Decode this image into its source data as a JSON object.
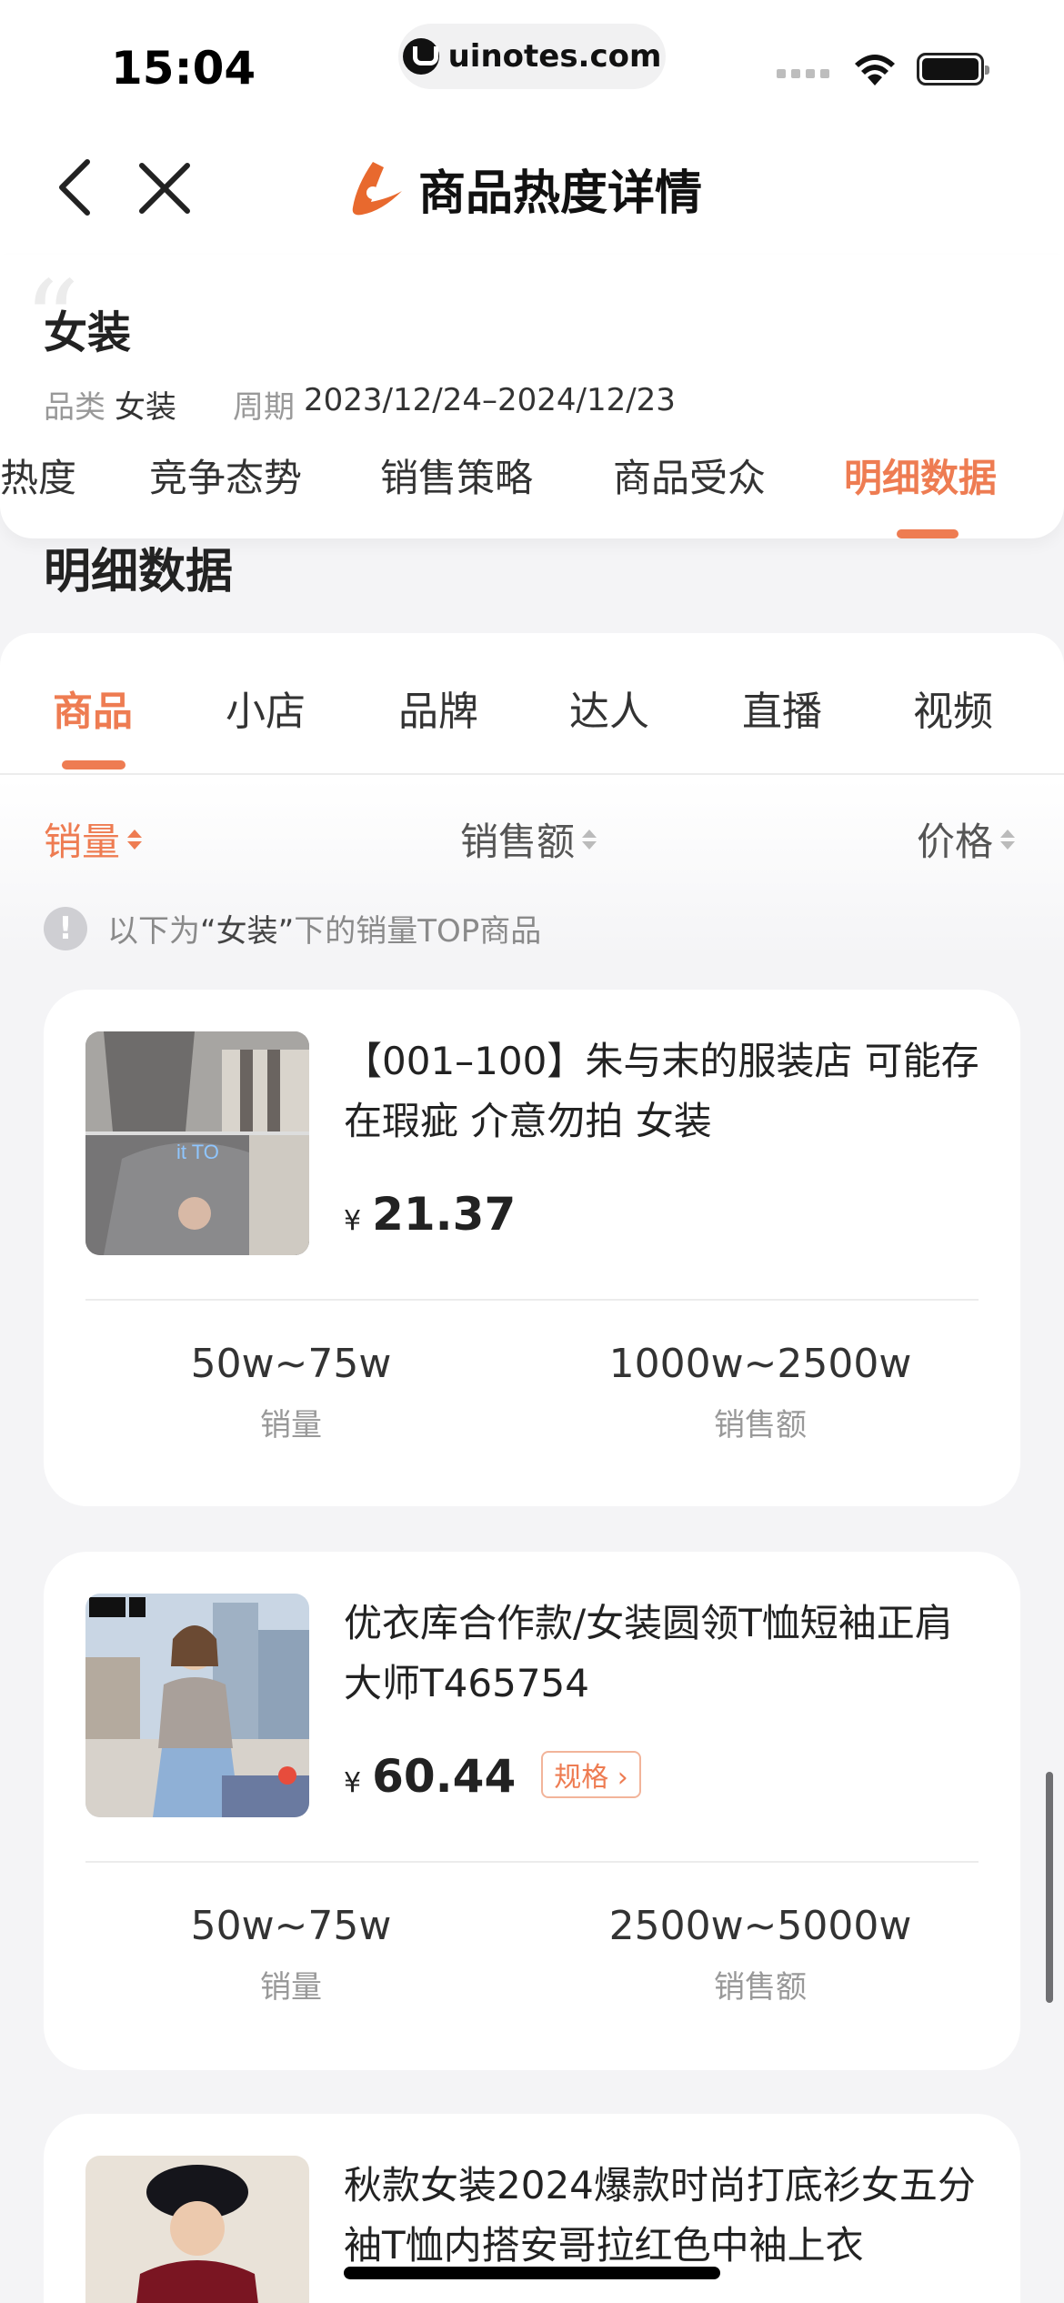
{
  "status_bar": {
    "time": "15:04",
    "url": "uinotes.com"
  },
  "nav": {
    "title": "商品热度详情"
  },
  "info": {
    "category_title": "女装",
    "category_label": "品类",
    "category_value": "女装",
    "period_label": "周期",
    "period_value": "2023/12/24–2024/12/23"
  },
  "top_tabs": [
    "热度",
    "竞争态势",
    "销售策略",
    "商品受众",
    "明细数据"
  ],
  "top_tab_active": "明细数据",
  "section_title": "明细数据",
  "sub_tabs": [
    "商品",
    "小店",
    "品牌",
    "达人",
    "直播",
    "视频"
  ],
  "sub_tab_active": "商品",
  "sort": {
    "sales": "销量",
    "revenue": "销售额",
    "price": "价格"
  },
  "notice": {
    "pre": "以下为",
    "highlight": "“女装”",
    "post": "下的销量TOP商品"
  },
  "products": [
    {
      "title": "【001–100】朱与末的服装店 可能存在瑕疵 介意勿拍 女装",
      "currency": "¥",
      "price": "21.37",
      "sales": "50w~75w",
      "sales_label": "销量",
      "revenue": "1000w~2500w",
      "revenue_label": "销售额"
    },
    {
      "title": "优衣库合作款/女装圆领T恤短袖正肩大师T465754",
      "currency": "¥",
      "price": "60.44",
      "spec_label": "规格",
      "sales": "50w~75w",
      "sales_label": "销量",
      "revenue": "2500w~5000w",
      "revenue_label": "销售额"
    },
    {
      "title": "秋款女装2024爆款时尚打底衫女五分袖T恤内搭安哥拉红色中袖上衣"
    }
  ],
  "colors": {
    "accent": "#ee7c52",
    "background": "#f4f4f6"
  },
  "icons": [
    "back-icon",
    "close-icon",
    "brand-logo-icon",
    "sort-arrows-icon",
    "info-icon",
    "chevron-right-icon"
  ]
}
